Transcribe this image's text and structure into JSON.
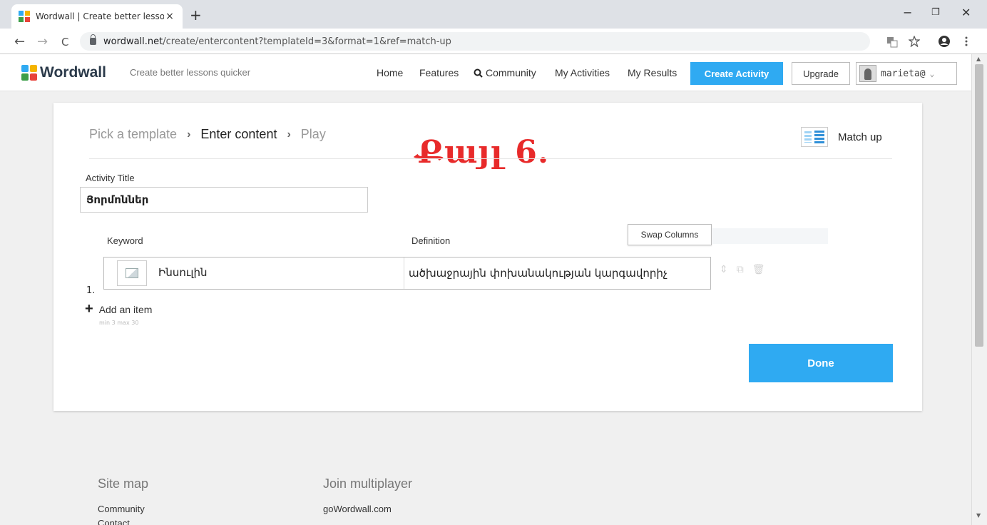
{
  "browser": {
    "tab_title": "Wordwall | Create better lessons",
    "tab_close": "×",
    "new_tab": "+",
    "controls": {
      "minimize": "−",
      "restore": "❐",
      "close": "✕"
    },
    "nav": {
      "back": "←",
      "forward": "→",
      "reload": "C"
    },
    "url_host": "wordwall.net",
    "url_path": "/create/entercontent?templateId=3&format=1&ref=match-up",
    "icons": [
      "translate-icon",
      "star-icon",
      "account-icon",
      "menu-icon"
    ]
  },
  "header": {
    "logo": "Wordwall",
    "logo_colors": [
      "#2faaf2",
      "#f4b400",
      "#3c9e48",
      "#e8433b"
    ],
    "tagline": "Create better lessons quicker",
    "nav": {
      "home": "Home",
      "features": "Features",
      "community": "Community",
      "my_activities": "My Activities",
      "my_results": "My Results"
    },
    "create_activity": "Create Activity",
    "upgrade": "Upgrade",
    "username": "marieta@"
  },
  "steps": {
    "pick": "Pick a template",
    "enter": "Enter content",
    "play": "Play",
    "arrow": "›"
  },
  "overlay_title": "Քայլ 6.",
  "template_name": "Match up",
  "activity_title": {
    "label": "Activity Title",
    "value": "Յորմոններ"
  },
  "columns": {
    "keyword": "Keyword",
    "definition": "Definition",
    "swap": "Swap Columns"
  },
  "items": [
    {
      "number": "1.",
      "keyword": "Ինսուլին",
      "definition": "ածխաջրային փոխանակության կարգավորիչ"
    }
  ],
  "add_item": "Add an item",
  "limits": "min 3   max 30",
  "done": "Done",
  "footer": {
    "site_map": "Site map",
    "join": "Join multiplayer",
    "community": "Community",
    "contact": "Contact",
    "go": "goWordwall.com"
  },
  "accent_color": "#2faaf2",
  "overlay_color": "#e82a2a"
}
